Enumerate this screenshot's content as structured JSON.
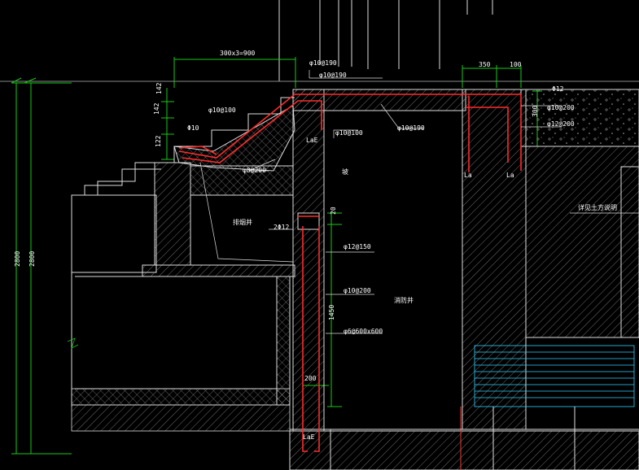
{
  "drawing": {
    "dimensions": {
      "steps": "300x3=900",
      "top_dim_a": "350",
      "top_dim_b": "100",
      "step_rise_1": "142",
      "step_rise_2": "142",
      "step_rise_3": "122",
      "overall_height_1": "2800",
      "overall_height_2": "2800",
      "gap_20": "20",
      "wall_1450": "1450",
      "wall_200": "200",
      "right_300": "300"
    },
    "labels": {
      "rebar_top_1": "φ10@190",
      "rebar_top_2": "φ10@190",
      "rebar_stair": "φ10@100",
      "rebar_stair_main": "Φ10",
      "rebar_dist": "φ8@200",
      "wall_vert": "φ10@100",
      "wall_mid": "φ10@190",
      "lae_1": "LaE",
      "lae_2": "LaE",
      "la_1": "La",
      "la_2": "La",
      "slab_dim": "Φ12",
      "right_1": "φ10@200",
      "right_2": "φ12@200",
      "hole_1": "2Φ12",
      "wall_h": "φ12@150",
      "wall_v": "φ10@200",
      "anchor": "φ6@600x600",
      "room_left": "排烟井",
      "room_mid": "消防井",
      "right_note": "详见土方说明",
      "tick_mark": "坡"
    }
  }
}
